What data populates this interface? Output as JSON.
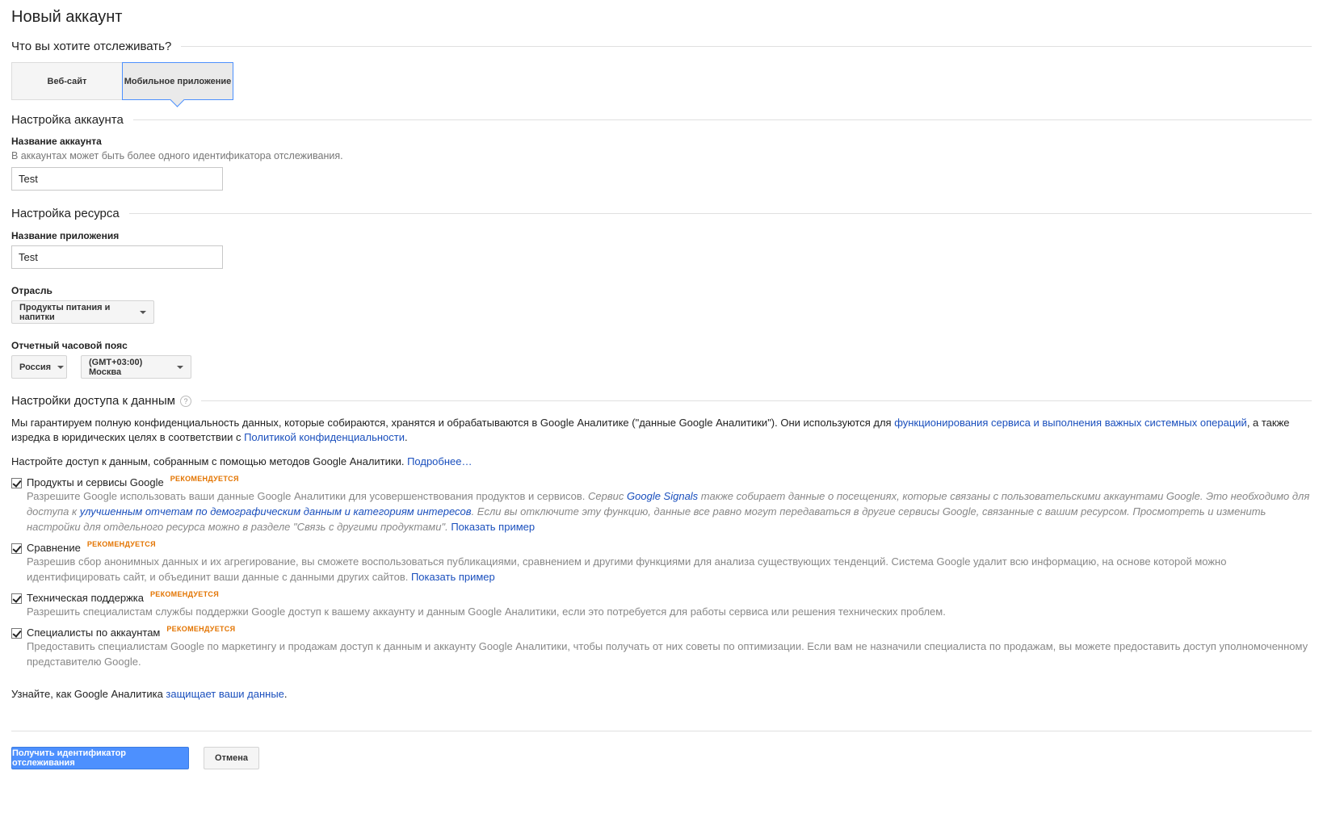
{
  "page": {
    "title": "Новый аккаунт"
  },
  "track": {
    "heading": "Что вы хотите отслеживать?",
    "options": [
      "Веб-сайт",
      "Мобильное приложение"
    ],
    "selected": "Мобильное приложение"
  },
  "account": {
    "heading": "Настройка аккаунта",
    "name_label": "Название аккаунта",
    "name_hint": "В аккаунтах может быть более одного идентификатора отслеживания.",
    "name_value": "Test"
  },
  "property": {
    "heading": "Настройка ресурса",
    "app_label": "Название приложения",
    "app_value": "Test",
    "industry_label": "Отрасль",
    "industry_value": "Продукты питания и напитки",
    "tz_label": "Отчетный часовой пояс",
    "country_value": "Россия",
    "tz_value": "(GMT+03:00) Москва"
  },
  "sharing": {
    "heading": "Настройки доступа к данным",
    "intro_1": "Мы гарантируем полную конфиденциальность данных, которые собираются, хранятся и обрабатываются в Google Аналитике (\"данные Google Аналитики\"). Они используются для ",
    "intro_link_1": "функционирования сервиса и выполнения важных системных операций",
    "intro_2": ", а также изредка в юридических целях в соответствии с ",
    "intro_link_2": "Политикой конфиденциальности",
    "intro_3": ".",
    "config_text": "Настройте доступ к данным, собранным с помощью методов Google Аналитики. ",
    "config_link": "Подробнее…",
    "recommended": "РЕКОМЕНДУЕТСЯ",
    "items": [
      {
        "name": "Продукты и сервисы Google",
        "desc_1": "Разрешите Google использовать ваши данные Google Аналитики для усовершенствования продуктов и сервисов. ",
        "desc_i1": "Сервис ",
        "desc_link1": "Google Signals",
        "desc_i2": " также собирает данные о посещениях, которые связаны с пользовательскими аккаунтами Google. Это необходимо для доступа к ",
        "desc_link2": "улучшенным отчетам по демографическим данным и категориям интересов",
        "desc_i3": ". Если вы отключите эту функцию, данные все равно могут передаваться в другие сервисы Google, связанные с вашим ресурсом. Просмотреть и изменить настройки для отдельного ресурса можно в разделе \"Связь с другими продуктами\".",
        "link": "Показать пример"
      },
      {
        "name": "Сравнение",
        "desc": "Разрешив сбор анонимных данных и их агрегирование, вы сможете воспользоваться публикациями, сравнением и другими функциями для анализа существующих тенденций. Система Google удалит всю информацию, на основе которой можно идентифицировать сайт, и объединит ваши данные с данными других сайтов. ",
        "link": "Показать пример"
      },
      {
        "name": "Техническая поддержка",
        "desc": "Разрешить специалистам службы поддержки Google доступ к вашему аккаунту и данным Google Аналитики, если это потребуется для работы сервиса или решения технических проблем."
      },
      {
        "name": "Специалисты по аккаунтам",
        "desc": "Предоставить специалистам Google по маркетингу и продажам доступ к данным и аккаунту Google Аналитики, чтобы получать от них советы по оптимизации. Если вам не назначили специалиста по продажам, вы можете предоставить доступ уполномоченному представителю Google."
      }
    ],
    "footer_text": "Узнайте, как Google Аналитика ",
    "footer_link": "защищает ваши данные",
    "footer_end": "."
  },
  "actions": {
    "submit": "Получить идентификатор отслеживания",
    "cancel": "Отмена"
  }
}
